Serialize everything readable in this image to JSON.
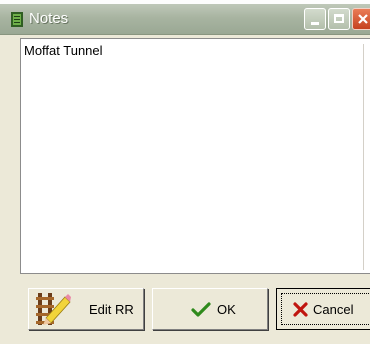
{
  "window": {
    "title": "Notes",
    "icon": "notes-app-icon",
    "controls": {
      "minimize_icon": "minimize-icon",
      "maximize_icon": "maximize-icon",
      "close_icon": "close-icon"
    }
  },
  "notes": {
    "text": "Moffat Tunnel"
  },
  "buttons": {
    "edit_rr": {
      "label": "Edit RR",
      "icon": "track-pencil-icon"
    },
    "ok": {
      "label": "OK",
      "icon": "checkmark-icon"
    },
    "cancel": {
      "label": "Cancel",
      "icon": "x-icon"
    }
  },
  "colors": {
    "titlebar": "#a8b4a1",
    "close_button": "#c5421f",
    "ok_check": "#2f8a1c",
    "cancel_x": "#c0160f",
    "dialog_bg": "#ece9d8"
  }
}
